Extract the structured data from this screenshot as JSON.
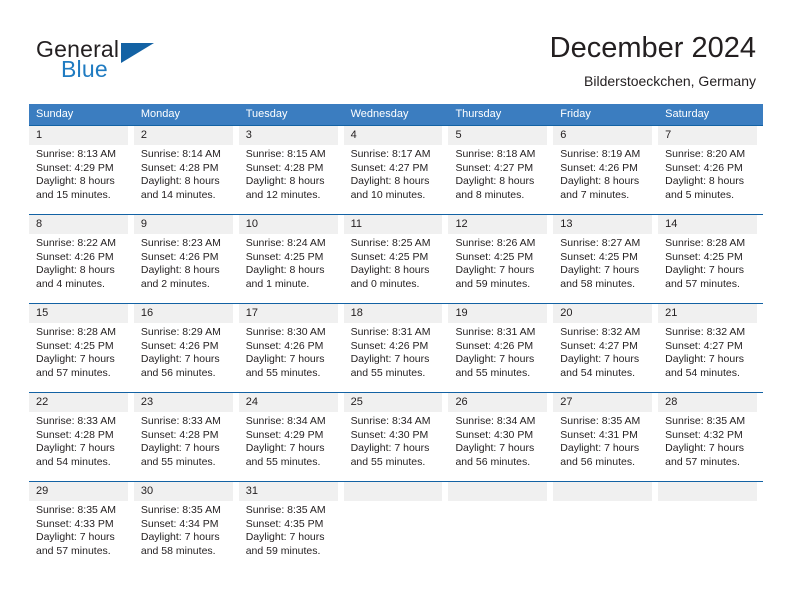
{
  "brand": {
    "name_top": "General",
    "name_bottom": "Blue",
    "triangle_icon": "triangle-icon",
    "accent_color": "#1362a4",
    "blue_text_color": "#1f7bc1"
  },
  "header": {
    "title": "December 2024",
    "subtitle": "Bilderstoeckchen, Germany"
  },
  "calendar": {
    "header_bg": "#3b7dc0",
    "daynum_bg": "#f0f0f0",
    "row_border_color": "#1362a4",
    "weekdays": [
      "Sunday",
      "Monday",
      "Tuesday",
      "Wednesday",
      "Thursday",
      "Friday",
      "Saturday"
    ],
    "weeks": [
      [
        {
          "day": "1",
          "sunrise": "Sunrise: 8:13 AM",
          "sunset": "Sunset: 4:29 PM",
          "daylight_line1": "Daylight: 8 hours",
          "daylight_line2": "and 15 minutes."
        },
        {
          "day": "2",
          "sunrise": "Sunrise: 8:14 AM",
          "sunset": "Sunset: 4:28 PM",
          "daylight_line1": "Daylight: 8 hours",
          "daylight_line2": "and 14 minutes."
        },
        {
          "day": "3",
          "sunrise": "Sunrise: 8:15 AM",
          "sunset": "Sunset: 4:28 PM",
          "daylight_line1": "Daylight: 8 hours",
          "daylight_line2": "and 12 minutes."
        },
        {
          "day": "4",
          "sunrise": "Sunrise: 8:17 AM",
          "sunset": "Sunset: 4:27 PM",
          "daylight_line1": "Daylight: 8 hours",
          "daylight_line2": "and 10 minutes."
        },
        {
          "day": "5",
          "sunrise": "Sunrise: 8:18 AM",
          "sunset": "Sunset: 4:27 PM",
          "daylight_line1": "Daylight: 8 hours",
          "daylight_line2": "and 8 minutes."
        },
        {
          "day": "6",
          "sunrise": "Sunrise: 8:19 AM",
          "sunset": "Sunset: 4:26 PM",
          "daylight_line1": "Daylight: 8 hours",
          "daylight_line2": "and 7 minutes."
        },
        {
          "day": "7",
          "sunrise": "Sunrise: 8:20 AM",
          "sunset": "Sunset: 4:26 PM",
          "daylight_line1": "Daylight: 8 hours",
          "daylight_line2": "and 5 minutes."
        }
      ],
      [
        {
          "day": "8",
          "sunrise": "Sunrise: 8:22 AM",
          "sunset": "Sunset: 4:26 PM",
          "daylight_line1": "Daylight: 8 hours",
          "daylight_line2": "and 4 minutes."
        },
        {
          "day": "9",
          "sunrise": "Sunrise: 8:23 AM",
          "sunset": "Sunset: 4:26 PM",
          "daylight_line1": "Daylight: 8 hours",
          "daylight_line2": "and 2 minutes."
        },
        {
          "day": "10",
          "sunrise": "Sunrise: 8:24 AM",
          "sunset": "Sunset: 4:25 PM",
          "daylight_line1": "Daylight: 8 hours",
          "daylight_line2": "and 1 minute."
        },
        {
          "day": "11",
          "sunrise": "Sunrise: 8:25 AM",
          "sunset": "Sunset: 4:25 PM",
          "daylight_line1": "Daylight: 8 hours",
          "daylight_line2": "and 0 minutes."
        },
        {
          "day": "12",
          "sunrise": "Sunrise: 8:26 AM",
          "sunset": "Sunset: 4:25 PM",
          "daylight_line1": "Daylight: 7 hours",
          "daylight_line2": "and 59 minutes."
        },
        {
          "day": "13",
          "sunrise": "Sunrise: 8:27 AM",
          "sunset": "Sunset: 4:25 PM",
          "daylight_line1": "Daylight: 7 hours",
          "daylight_line2": "and 58 minutes."
        },
        {
          "day": "14",
          "sunrise": "Sunrise: 8:28 AM",
          "sunset": "Sunset: 4:25 PM",
          "daylight_line1": "Daylight: 7 hours",
          "daylight_line2": "and 57 minutes."
        }
      ],
      [
        {
          "day": "15",
          "sunrise": "Sunrise: 8:28 AM",
          "sunset": "Sunset: 4:25 PM",
          "daylight_line1": "Daylight: 7 hours",
          "daylight_line2": "and 57 minutes."
        },
        {
          "day": "16",
          "sunrise": "Sunrise: 8:29 AM",
          "sunset": "Sunset: 4:26 PM",
          "daylight_line1": "Daylight: 7 hours",
          "daylight_line2": "and 56 minutes."
        },
        {
          "day": "17",
          "sunrise": "Sunrise: 8:30 AM",
          "sunset": "Sunset: 4:26 PM",
          "daylight_line1": "Daylight: 7 hours",
          "daylight_line2": "and 55 minutes."
        },
        {
          "day": "18",
          "sunrise": "Sunrise: 8:31 AM",
          "sunset": "Sunset: 4:26 PM",
          "daylight_line1": "Daylight: 7 hours",
          "daylight_line2": "and 55 minutes."
        },
        {
          "day": "19",
          "sunrise": "Sunrise: 8:31 AM",
          "sunset": "Sunset: 4:26 PM",
          "daylight_line1": "Daylight: 7 hours",
          "daylight_line2": "and 55 minutes."
        },
        {
          "day": "20",
          "sunrise": "Sunrise: 8:32 AM",
          "sunset": "Sunset: 4:27 PM",
          "daylight_line1": "Daylight: 7 hours",
          "daylight_line2": "and 54 minutes."
        },
        {
          "day": "21",
          "sunrise": "Sunrise: 8:32 AM",
          "sunset": "Sunset: 4:27 PM",
          "daylight_line1": "Daylight: 7 hours",
          "daylight_line2": "and 54 minutes."
        }
      ],
      [
        {
          "day": "22",
          "sunrise": "Sunrise: 8:33 AM",
          "sunset": "Sunset: 4:28 PM",
          "daylight_line1": "Daylight: 7 hours",
          "daylight_line2": "and 54 minutes."
        },
        {
          "day": "23",
          "sunrise": "Sunrise: 8:33 AM",
          "sunset": "Sunset: 4:28 PM",
          "daylight_line1": "Daylight: 7 hours",
          "daylight_line2": "and 55 minutes."
        },
        {
          "day": "24",
          "sunrise": "Sunrise: 8:34 AM",
          "sunset": "Sunset: 4:29 PM",
          "daylight_line1": "Daylight: 7 hours",
          "daylight_line2": "and 55 minutes."
        },
        {
          "day": "25",
          "sunrise": "Sunrise: 8:34 AM",
          "sunset": "Sunset: 4:30 PM",
          "daylight_line1": "Daylight: 7 hours",
          "daylight_line2": "and 55 minutes."
        },
        {
          "day": "26",
          "sunrise": "Sunrise: 8:34 AM",
          "sunset": "Sunset: 4:30 PM",
          "daylight_line1": "Daylight: 7 hours",
          "daylight_line2": "and 56 minutes."
        },
        {
          "day": "27",
          "sunrise": "Sunrise: 8:35 AM",
          "sunset": "Sunset: 4:31 PM",
          "daylight_line1": "Daylight: 7 hours",
          "daylight_line2": "and 56 minutes."
        },
        {
          "day": "28",
          "sunrise": "Sunrise: 8:35 AM",
          "sunset": "Sunset: 4:32 PM",
          "daylight_line1": "Daylight: 7 hours",
          "daylight_line2": "and 57 minutes."
        }
      ],
      [
        {
          "day": "29",
          "sunrise": "Sunrise: 8:35 AM",
          "sunset": "Sunset: 4:33 PM",
          "daylight_line1": "Daylight: 7 hours",
          "daylight_line2": "and 57 minutes."
        },
        {
          "day": "30",
          "sunrise": "Sunrise: 8:35 AM",
          "sunset": "Sunset: 4:34 PM",
          "daylight_line1": "Daylight: 7 hours",
          "daylight_line2": "and 58 minutes."
        },
        {
          "day": "31",
          "sunrise": "Sunrise: 8:35 AM",
          "sunset": "Sunset: 4:35 PM",
          "daylight_line1": "Daylight: 7 hours",
          "daylight_line2": "and 59 minutes."
        },
        {
          "day": "",
          "sunrise": "",
          "sunset": "",
          "daylight_line1": "",
          "daylight_line2": ""
        },
        {
          "day": "",
          "sunrise": "",
          "sunset": "",
          "daylight_line1": "",
          "daylight_line2": ""
        },
        {
          "day": "",
          "sunrise": "",
          "sunset": "",
          "daylight_line1": "",
          "daylight_line2": ""
        },
        {
          "day": "",
          "sunrise": "",
          "sunset": "",
          "daylight_line1": "",
          "daylight_line2": ""
        }
      ]
    ]
  }
}
